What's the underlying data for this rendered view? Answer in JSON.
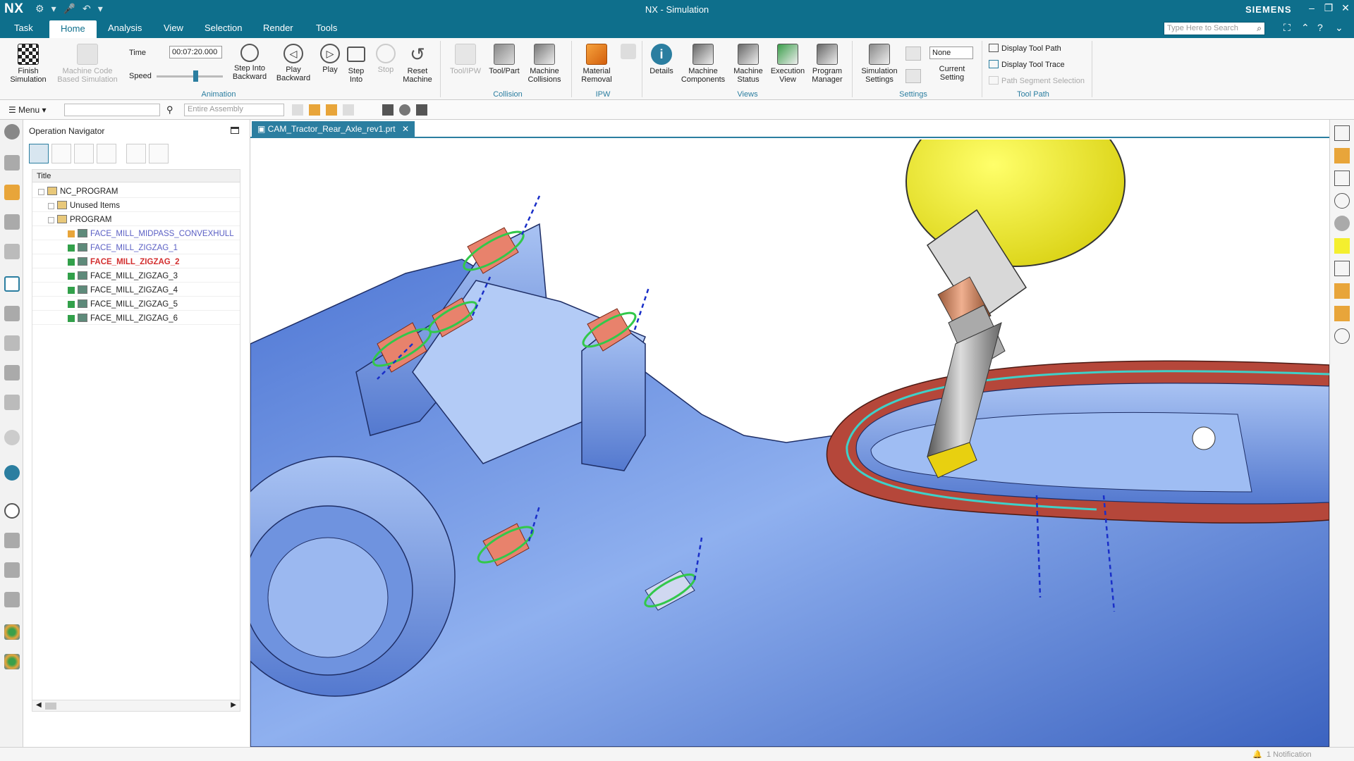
{
  "titlebar": {
    "logo": "NX",
    "title": "NX - Simulation",
    "brand": "SIEMENS",
    "minimize": "–",
    "restore": "❐",
    "close": "✕"
  },
  "menubar": {
    "items": [
      "Task",
      "Home",
      "Analysis",
      "View",
      "Selection",
      "Render",
      "Tools"
    ],
    "active": "Home",
    "search_placeholder": "Type Here to Search"
  },
  "ribbon": {
    "finish_simulation": "Finish Simulation",
    "machine_code": "Machine Code Based Simulation",
    "time_label": "Time",
    "time_value": "00:07:20.000",
    "speed_label": "Speed",
    "speed_level": 0.55,
    "step_into_backward": "Step Into Backward",
    "play_backward": "Play Backward",
    "play": "Play",
    "step_into": "Step Into",
    "stop": "Stop",
    "reset_machine": "Reset Machine",
    "tool_ipw": "Tool/IPW",
    "tool_part": "Tool/Part",
    "machine_collisions": "Machine Collisions",
    "material_removal": "Material Removal",
    "details": "Details",
    "machine_components": "Machine Components",
    "machine_status": "Machine Status",
    "execution_view": "Execution View",
    "program_manager": "Program Manager",
    "simulation_settings": "Simulation Settings",
    "none_value": "None",
    "current_setting": "Current Setting",
    "display_tool_path": "Display Tool Path",
    "display_tool_trace": "Display Tool Trace",
    "path_segment_selection": "Path Segment Selection",
    "groups": {
      "animation": "Animation",
      "collision": "Collision",
      "ipw": "IPW",
      "views": "Views",
      "settings": "Settings",
      "tool_path": "Tool Path"
    }
  },
  "toolbar2": {
    "menu_label": "Menu",
    "filter_value": "",
    "scope_value": "Entire Assembly"
  },
  "navigator": {
    "title": "Operation Navigator",
    "column_title": "Title",
    "rows": [
      {
        "label": "NC_PROGRAM",
        "indent": 0,
        "color": "#222"
      },
      {
        "label": "Unused Items",
        "indent": 1,
        "color": "#222"
      },
      {
        "label": "PROGRAM",
        "indent": 1,
        "color": "#222"
      },
      {
        "label": "FACE_MILL_MIDPASS_CONVEXHULL",
        "indent": 2,
        "color": "#5a5fc4"
      },
      {
        "label": "FACE_MILL_ZIGZAG_1",
        "indent": 2,
        "color": "#5a5fc4"
      },
      {
        "label": "FACE_MILL_ZIGZAG_2",
        "indent": 2,
        "color": "#d32f2f"
      },
      {
        "label": "FACE_MILL_ZIGZAG_3",
        "indent": 2,
        "color": "#222"
      },
      {
        "label": "FACE_MILL_ZIGZAG_4",
        "indent": 2,
        "color": "#222"
      },
      {
        "label": "FACE_MILL_ZIGZAG_5",
        "indent": 2,
        "color": "#222"
      },
      {
        "label": "FACE_MILL_ZIGZAG_6",
        "indent": 2,
        "color": "#222"
      }
    ]
  },
  "tab": {
    "label": "CAM_Tractor_Rear_Axle_rev1.prt",
    "close": "✕"
  },
  "status": {
    "notification": "1 Notification"
  },
  "colors": {
    "accent": "#0e6f8c",
    "part_blue": "#6f93df",
    "tool_yellow": "#f4ef2f",
    "pad_orange": "#e8826c",
    "path_cyan": "#3fd0c8",
    "path_green": "#32c84a",
    "flange_red": "#b5473a"
  }
}
